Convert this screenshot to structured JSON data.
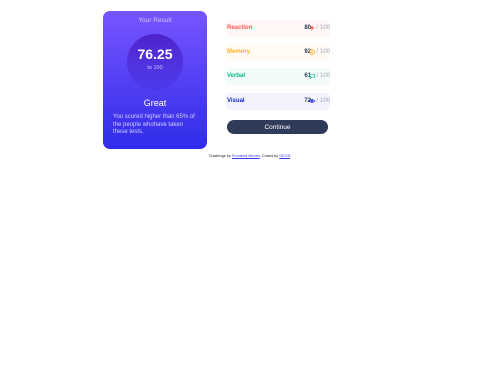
{
  "result": {
    "heading": "Your Result",
    "score": "76.25",
    "out_of": "to 100",
    "rating": "Great",
    "description": "You scored higher than 65% of the people whohave taken these tests."
  },
  "summary": {
    "rows": [
      {
        "label": "Reaction",
        "score": "80",
        "slash": "/",
        "max": "100",
        "color": "#ff5757",
        "bg": "#fff6f5",
        "icon": "bolt-icon"
      },
      {
        "label": "Memory",
        "score": "92",
        "slash": "/",
        "max": "100",
        "color": "#ffb01f",
        "bg": "#fffbf2",
        "icon": "brain-icon"
      },
      {
        "label": "Verbal",
        "score": "61",
        "slash": "/",
        "max": "100",
        "color": "#00bb8f",
        "bg": "#f2fbfa",
        "icon": "chat-icon"
      },
      {
        "label": "Visual",
        "score": "72",
        "slash": "/",
        "max": "100",
        "color": "#1125d4",
        "bg": "#f3f3fd",
        "icon": "eye-icon"
      }
    ]
  },
  "continue_label": "Continue",
  "attribution": {
    "prefix": "Challenge by",
    "link1": "Frontend Mentor",
    "middle": ". Coded by",
    "link2": "GEOS",
    "suffix": "."
  }
}
